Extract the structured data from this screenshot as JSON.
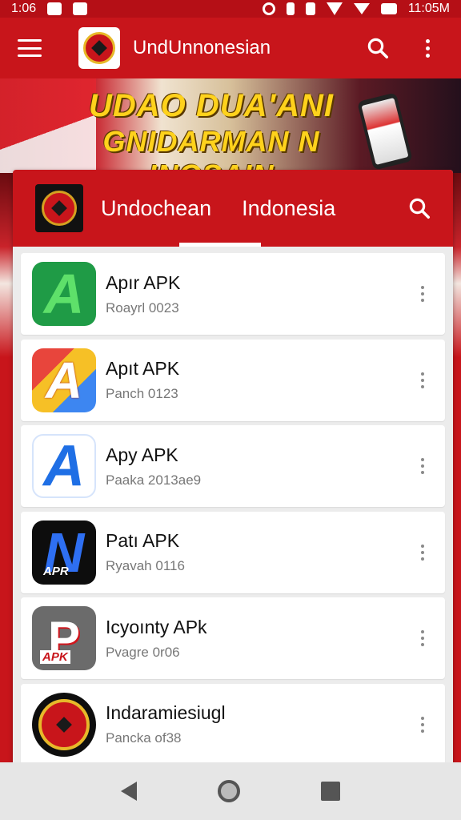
{
  "status_bar": {
    "time": "1:06",
    "clock_right": "11:05M"
  },
  "app_bar": {
    "title": "UndUnnonesian",
    "logo_icon": "garuda-emblem"
  },
  "banner": {
    "line1": "UDAO DUA'ANI",
    "line2": "GNIDARMAN N INOSAIN"
  },
  "card": {
    "tabs": [
      {
        "label": "Undochean"
      },
      {
        "label": "Indonesia"
      }
    ],
    "selected_tab": 0
  },
  "apps": [
    {
      "name": "Apır APK",
      "sub": "Roayrl 0023",
      "icon": "green-a-icon",
      "glyph": "A"
    },
    {
      "name": "Apıt APK",
      "sub": "Panch 0123",
      "icon": "multicolor-a-icon",
      "glyph": "A"
    },
    {
      "name": "Apy APK",
      "sub": "Paaka 2013ae9",
      "icon": "blue-a-icon",
      "glyph": "A"
    },
    {
      "name": "Patı APK",
      "sub": "Ryavah 0116",
      "icon": "black-apk-icon",
      "glyph": "N",
      "tag": "APR"
    },
    {
      "name": "Icyoınty APk",
      "sub": "Pvagre 0r06",
      "icon": "grey-apk-icon",
      "glyph": "P",
      "tag": "APK"
    },
    {
      "name": "Indaramiesiugl",
      "sub": "Pancka of38",
      "icon": "garuda-badge-icon"
    }
  ],
  "colors": {
    "primary": "#c8151b",
    "card_bg": "#ececec"
  }
}
